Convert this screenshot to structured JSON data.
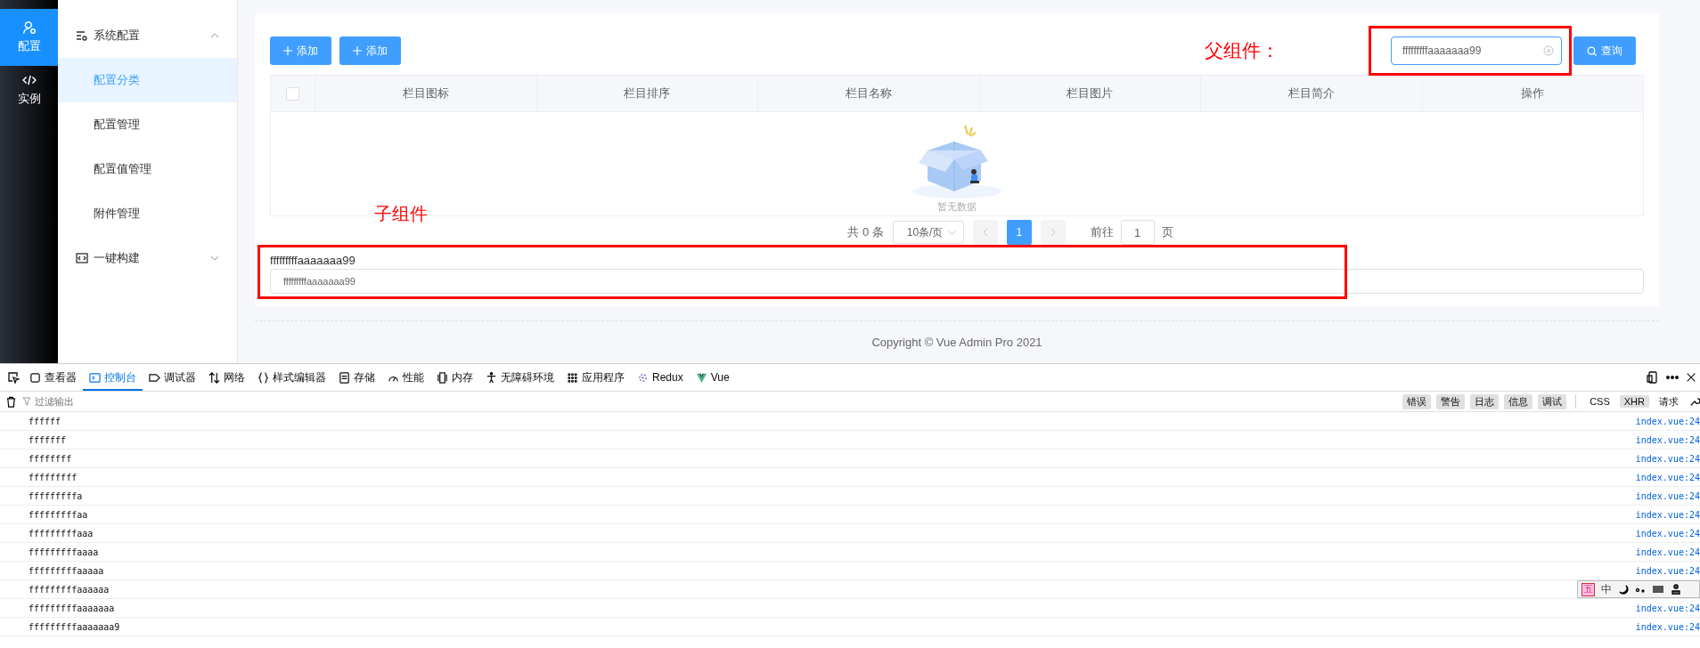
{
  "rail": [
    {
      "label": "配置",
      "selected": true
    },
    {
      "label": "实例",
      "selected": false
    }
  ],
  "submenu": [
    {
      "label": "系统配置",
      "expanded": true,
      "children": [
        {
          "label": "配置分类",
          "selected": true
        },
        {
          "label": "配置管理",
          "selected": false
        },
        {
          "label": "配置值管理",
          "selected": false
        },
        {
          "label": "附件管理",
          "selected": false
        }
      ]
    },
    {
      "label": "一键构建",
      "expanded": false
    }
  ],
  "toolbar": {
    "buttons": [
      "添加",
      "添加"
    ],
    "parent_annotation": "父组件：",
    "search": {
      "value": "fffffffffaaaaaaa99"
    },
    "query_button": "查询"
  },
  "table": {
    "columns": [
      "栏目图标",
      "栏目排序",
      "栏目名称",
      "栏目图片",
      "栏目简介",
      "操作"
    ],
    "select_all_checked": false,
    "empty_text": "暂无数据"
  },
  "child_annotation": "子组件",
  "pagination": {
    "total": "共 0 条",
    "page_size": "10条/页",
    "pages": [
      {
        "label": "1",
        "selected": true
      }
    ],
    "goto_label": "前往",
    "goto_value": "1",
    "goto_suffix": "页"
  },
  "child": {
    "text": "fffffffffaaaaaaa99",
    "input_value": "fffffffffaaaaaaa99"
  },
  "footer": "Copyright © Vue Admin Pro 2021",
  "devtools": {
    "tabs": [
      {
        "label": "查看器",
        "selected": false
      },
      {
        "label": "控制台",
        "selected": true
      },
      {
        "label": "调试器",
        "selected": false
      },
      {
        "label": "网络",
        "selected": false
      },
      {
        "label": "样式编辑器",
        "selected": false
      },
      {
        "label": "存储",
        "selected": false
      },
      {
        "label": "性能",
        "selected": false
      },
      {
        "label": "内存",
        "selected": false
      },
      {
        "label": "无障碍环境",
        "selected": false
      },
      {
        "label": "应用程序",
        "selected": false
      },
      {
        "label": "Redux",
        "selected": false
      },
      {
        "label": "Vue",
        "selected": false
      }
    ],
    "filter_placeholder": "过滤输出",
    "levels": [
      {
        "label": "错误",
        "selected": true
      },
      {
        "label": "警告",
        "selected": true
      },
      {
        "label": "日志",
        "selected": true
      },
      {
        "label": "信息",
        "selected": true
      },
      {
        "label": "调试",
        "selected": true
      }
    ],
    "types": [
      {
        "label": "CSS",
        "selected": false
      },
      {
        "label": "XHR",
        "selected": true
      },
      {
        "label": "请求",
        "selected": false
      }
    ],
    "rows": [
      {
        "text": "ffffff",
        "source": "index.vue:24"
      },
      {
        "text": "fffffff",
        "source": "index.vue:24"
      },
      {
        "text": "ffffffff",
        "source": "index.vue:24"
      },
      {
        "text": "fffffffff",
        "source": "index.vue:24"
      },
      {
        "text": "fffffffffa",
        "source": "index.vue:24"
      },
      {
        "text": "fffffffffaa",
        "source": "index.vue:24"
      },
      {
        "text": "fffffffffaaa",
        "source": "index.vue:24"
      },
      {
        "text": "fffffffffaaaa",
        "source": "index.vue:24"
      },
      {
        "text": "fffffffffaaaaa",
        "source": "index.vue:24"
      },
      {
        "text": "fffffffffaaaaaa"
      },
      {
        "text": "fffffffffaaaaaaa",
        "source": "index.vue:24"
      },
      {
        "text": "fffffffffaaaaaaa9",
        "source": "index.vue:24"
      }
    ]
  },
  "ime_toolbar": {
    "mode": "五",
    "language": "中"
  }
}
